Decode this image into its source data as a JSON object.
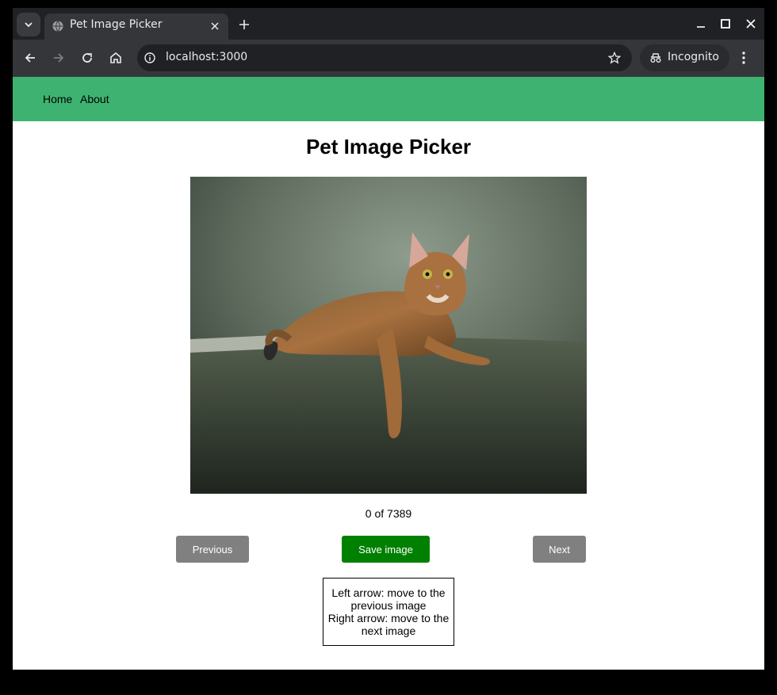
{
  "browser": {
    "tab_title": "Pet Image Picker",
    "url": "localhost:3000",
    "incognito_label": "Incognito"
  },
  "nav": {
    "items": [
      {
        "label": "Home"
      },
      {
        "label": "About"
      }
    ],
    "color": "#3eb371"
  },
  "main": {
    "title": "Pet Image Picker",
    "counter": "0 of 7389",
    "buttons": {
      "previous": "Previous",
      "save": "Save image",
      "next": "Next"
    },
    "help": {
      "line1": "Left arrow: move to the previous image",
      "line2": "Right arrow: move to the next image"
    }
  },
  "colors": {
    "save_button": "#008000",
    "secondary_button": "#808080"
  }
}
